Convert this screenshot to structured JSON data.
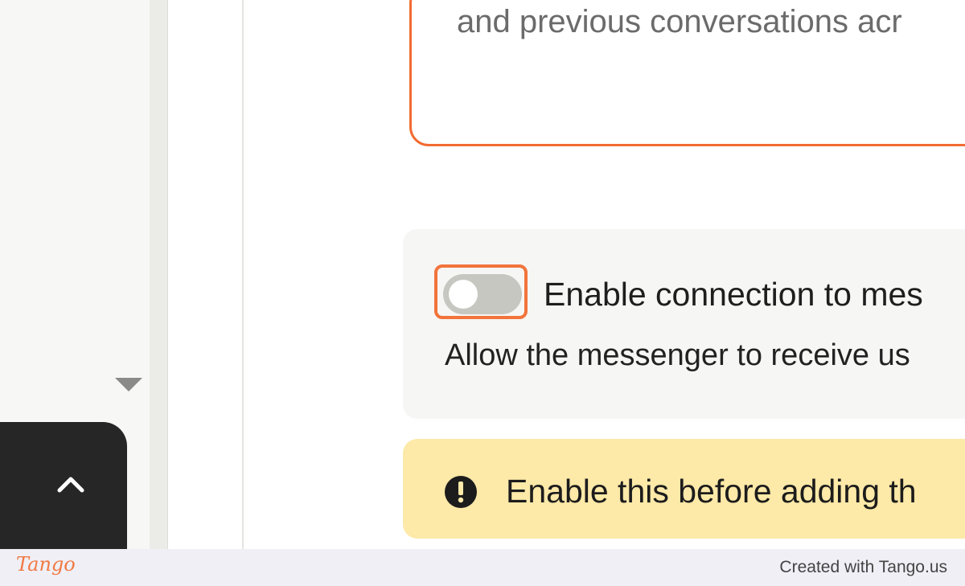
{
  "message_card": {
    "text": "and previous conversations acr"
  },
  "setting": {
    "toggle_state": "off",
    "title": "Enable connection to mes",
    "description": "Allow the messenger to receive us"
  },
  "warning": {
    "icon": "exclamation-circle-icon",
    "text": "Enable this before adding th"
  },
  "scroll_top": {
    "icon": "chevron-up-icon"
  },
  "footer": {
    "logo": "Tango",
    "credit": "Created with Tango.us"
  },
  "colors": {
    "accent": "#f26b32",
    "warning_bg": "#fde9a8",
    "toggle_off": "#c6c7c0"
  }
}
